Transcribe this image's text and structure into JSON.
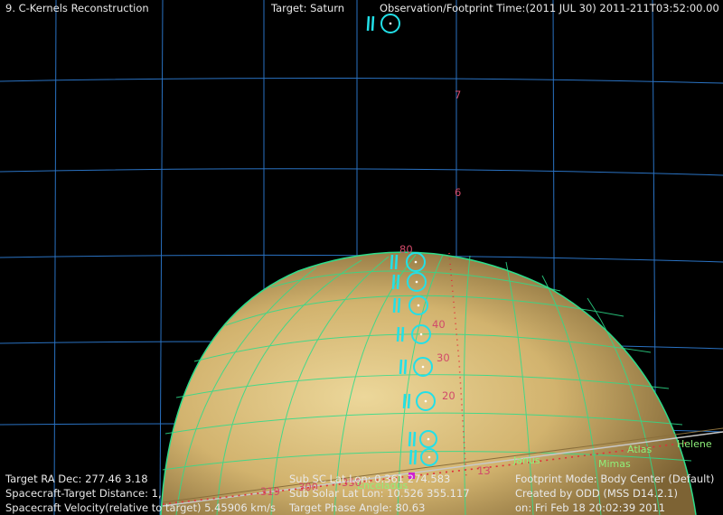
{
  "header": {
    "title": "9. C-Kernels Reconstruction",
    "target": "Target: Saturn",
    "observation": "Observation/Footprint Time:(2011 JUL 30) 2011-211T03:52:00.00"
  },
  "info_left": {
    "ra_dec": "Target RA Dec:  277.46     3.18",
    "distance": "Spacecraft-Target Distance: 1,",
    "velocity": "Spacecraft Velocity(relative to target) 5.45906 km/s"
  },
  "info_center": {
    "sub_sc": "Sub SC Lat Lon:   0.361   274.583",
    "sub_solar": "Sub Solar Lat Lon: 10.526   355.117",
    "phase": "Target Phase Angle:  80.63"
  },
  "info_right": {
    "mode": "Footprint Mode: Body Center (Default)",
    "created": "Created by ODD (MSS D14.2.1)",
    "date": "on: Fri Feb 18 20:02:39 2011"
  },
  "moons": [
    "Helene",
    "Atlas",
    "Janus",
    "Mimas",
    "Enceladus"
  ],
  "grid_labels": [
    "7",
    "6",
    "80",
    "40",
    "30",
    "20"
  ],
  "track_numbers": [
    "319",
    "300",
    "350",
    "13"
  ],
  "colors": {
    "background": "#000000",
    "grid": "#2f7fd8",
    "planet_light": "#e8cf8c",
    "planet_dark": "#8a6f3c",
    "planet_grid": "#2ddc8a",
    "footprint": "#22e0e8",
    "track": "#e0303a",
    "label": "#e8e8e8"
  }
}
